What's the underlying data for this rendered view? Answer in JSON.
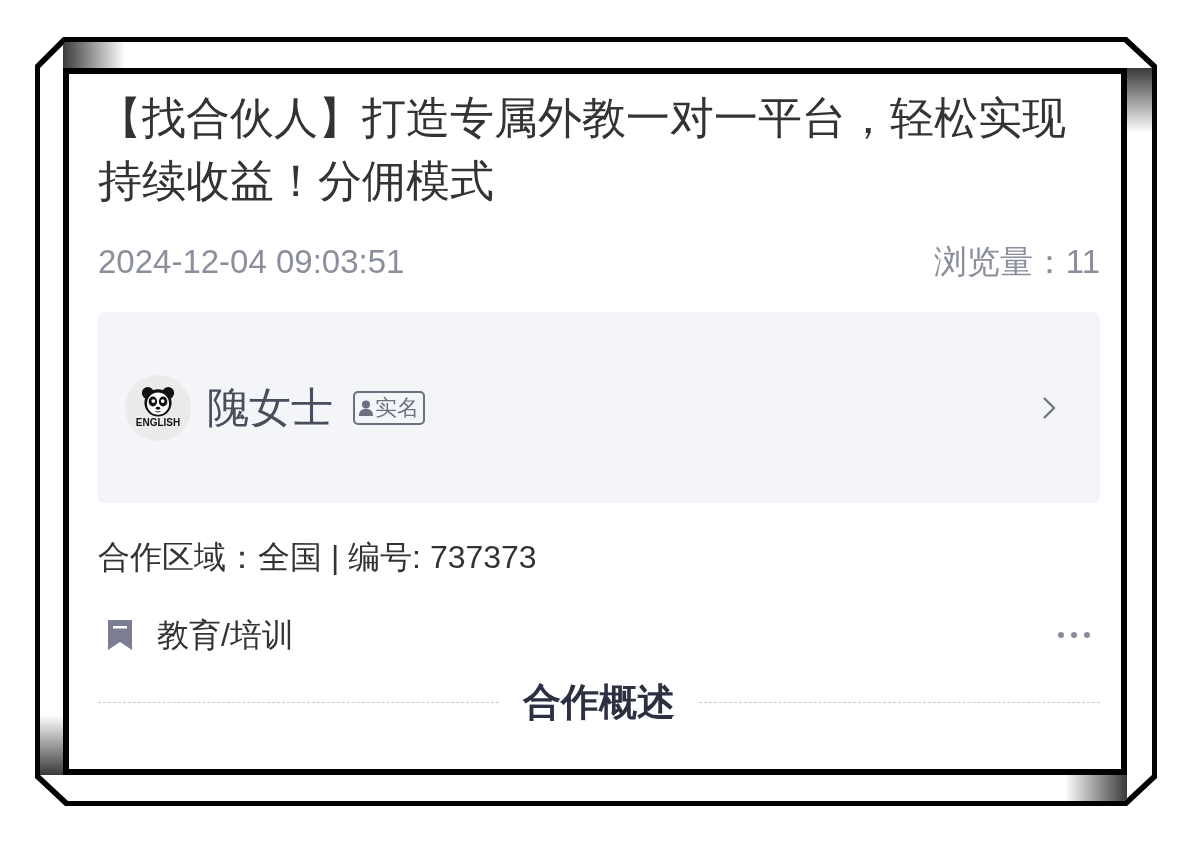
{
  "post": {
    "title": "【找合伙人】打造专属外教一对一平台，轻松实现持续收益！分佣模式",
    "datetime": "2024-12-04 09:03:51",
    "views": "浏览量：11"
  },
  "publisher": {
    "logo_text": "ENGLISH",
    "name": "隗女士",
    "badge": "实名"
  },
  "details": {
    "info": "合作区域：全国 | 编号: 737373",
    "category": "教育/培训"
  },
  "section": {
    "title": "合作概述"
  }
}
